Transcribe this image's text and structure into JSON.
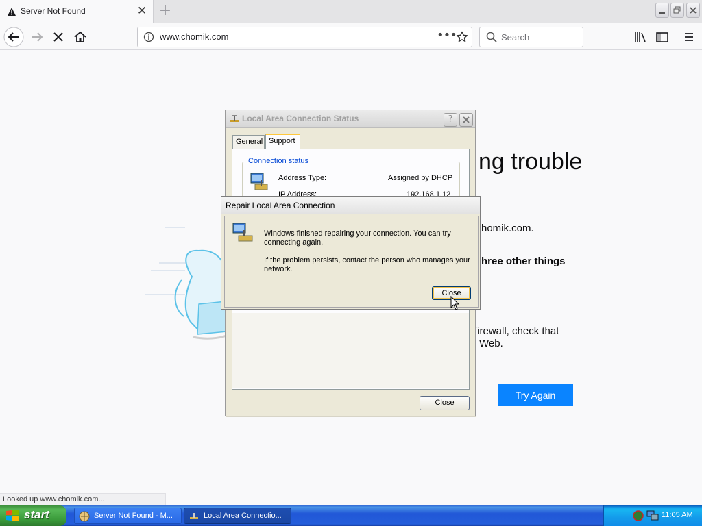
{
  "browser": {
    "tab_title": "Server Not Found",
    "url": "www.chomik.com",
    "search_placeholder": "Search",
    "status_text": "Looked up www.chomik.com..."
  },
  "page": {
    "heading_fragment": "ng trouble",
    "line1_fragment": "homik.com.",
    "line2_fragment": "hree other things",
    "line3a_fragment": "firewall, check that",
    "line3b_fragment": "Web.",
    "try_again_label": "Try Again"
  },
  "lac_dialog": {
    "title": "Local Area Connection Status",
    "help_label": "?",
    "tabs": [
      "General",
      "Support"
    ],
    "group_label": "Connection status",
    "rows": [
      {
        "label": "Address Type:",
        "value": "Assigned by DHCP"
      },
      {
        "label": "IP Address:",
        "value": "192.168.1.12"
      }
    ],
    "close_label": "Close"
  },
  "repair_dialog": {
    "title": "Repair Local Area Connection",
    "message1": "Windows finished repairing your connection. You can try connecting again.",
    "message2": "If the problem persists, contact the person who manages your network.",
    "close_label": "Close"
  },
  "taskbar": {
    "start_label": "start",
    "items": [
      {
        "label": "Server Not Found - M..."
      },
      {
        "label": "Local Area Connectio..."
      }
    ],
    "clock": "11:05 AM"
  },
  "colors": {
    "accent": "#0a84ff",
    "xp_taskbar": "#245edb",
    "xp_start": "#3a9a3a"
  }
}
